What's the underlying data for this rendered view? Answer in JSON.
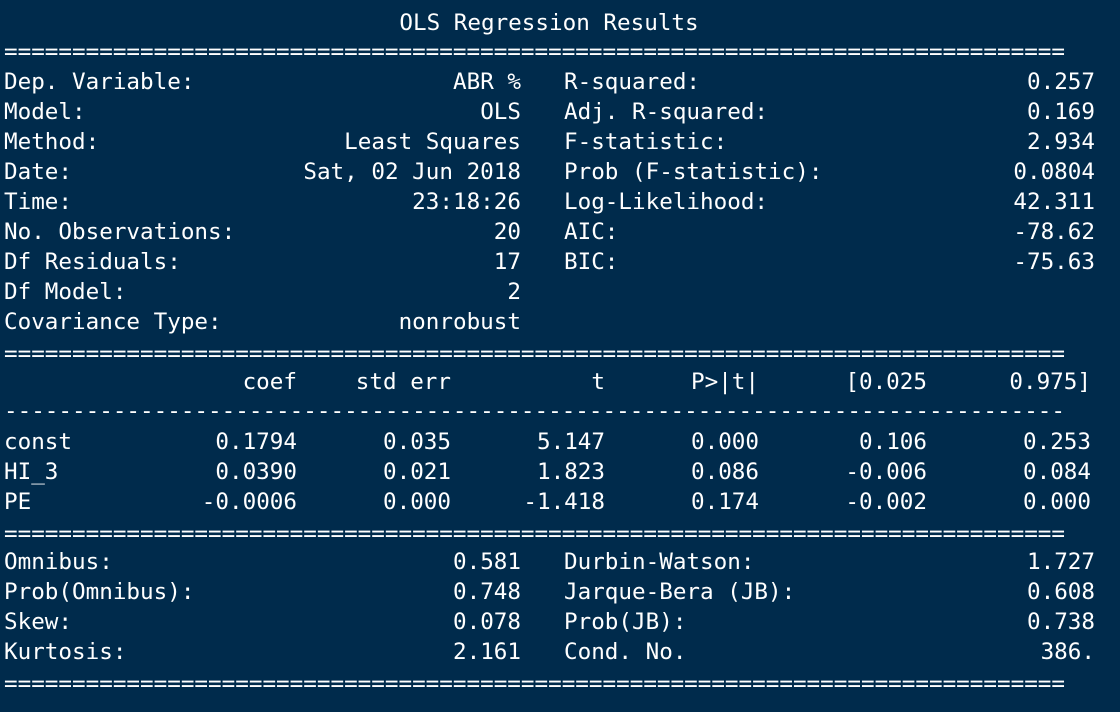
{
  "title": "OLS Regression Results",
  "top_stats": {
    "left": [
      {
        "label": "Dep. Variable:",
        "value": "ABR %"
      },
      {
        "label": "Model:",
        "value": "OLS"
      },
      {
        "label": "Method:",
        "value": "Least Squares"
      },
      {
        "label": "Date:",
        "value": "Sat, 02 Jun 2018"
      },
      {
        "label": "Time:",
        "value": "23:18:26"
      },
      {
        "label": "No. Observations:",
        "value": "20"
      },
      {
        "label": "Df Residuals:",
        "value": "17"
      },
      {
        "label": "Df Model:",
        "value": "2"
      },
      {
        "label": "Covariance Type:",
        "value": "nonrobust"
      }
    ],
    "right": [
      {
        "label": "R-squared:",
        "value": "0.257"
      },
      {
        "label": "Adj. R-squared:",
        "value": "0.169"
      },
      {
        "label": "F-statistic:",
        "value": "2.934"
      },
      {
        "label": "Prob (F-statistic):",
        "value": "0.0804"
      },
      {
        "label": "Log-Likelihood:",
        "value": "42.311"
      },
      {
        "label": "AIC:",
        "value": "-78.62"
      },
      {
        "label": "BIC:",
        "value": "-75.63"
      }
    ]
  },
  "coef_table": {
    "headers": [
      "coef",
      "std err",
      "t",
      "P>|t|",
      "[0.025",
      "0.975]"
    ],
    "rows": [
      {
        "name": "const",
        "cells": [
          "0.1794",
          "0.035",
          "5.147",
          "0.000",
          "0.106",
          "0.253"
        ]
      },
      {
        "name": "HI_3",
        "cells": [
          "0.0390",
          "0.021",
          "1.823",
          "0.086",
          "-0.006",
          "0.084"
        ]
      },
      {
        "name": "PE",
        "cells": [
          "-0.0006",
          "0.000",
          "-1.418",
          "0.174",
          "-0.002",
          "0.000"
        ]
      }
    ]
  },
  "bottom_stats": {
    "left": [
      {
        "label": "Omnibus:",
        "value": "0.581"
      },
      {
        "label": "Prob(Omnibus):",
        "value": "0.748"
      },
      {
        "label": "Skew:",
        "value": "0.078"
      },
      {
        "label": "Kurtosis:",
        "value": "2.161"
      }
    ],
    "right": [
      {
        "label": "Durbin-Watson:",
        "value": "1.727"
      },
      {
        "label": "Jarque-Bera (JB):",
        "value": "0.608"
      },
      {
        "label": "Prob(JB):",
        "value": "0.738"
      },
      {
        "label": "Cond. No.",
        "value": "386."
      }
    ]
  },
  "rules": {
    "double": "==============================================================================",
    "single": "------------------------------------------------------------------------------"
  },
  "colors": {
    "background": "#002b4c",
    "text": "#ffffff"
  }
}
